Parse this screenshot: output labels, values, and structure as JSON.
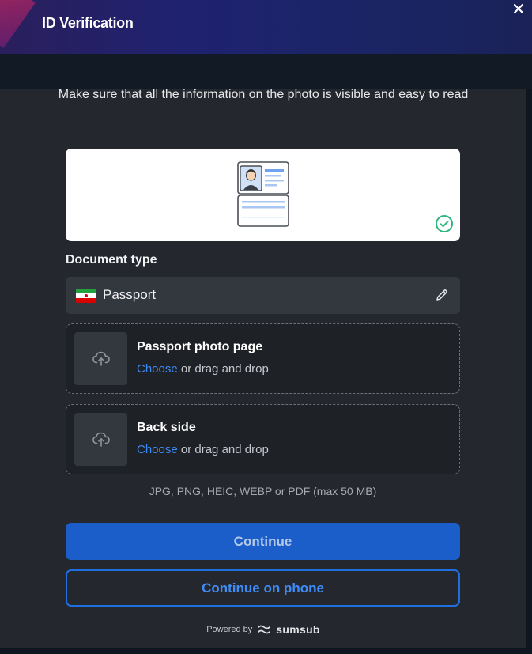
{
  "header": {
    "title": "ID Verification",
    "close_icon": "close-icon"
  },
  "main": {
    "instruction": "Make sure that all the information on the photo is visible and easy to read",
    "document_type_label": "Document type",
    "document_type_value": "Passport",
    "uploads": [
      {
        "title": "Passport photo page",
        "choose": "Choose",
        "hint": " or drag and drop"
      },
      {
        "title": "Back side",
        "choose": "Choose",
        "hint": " or drag and drop"
      }
    ],
    "formats": "JPG, PNG, HEIC, WEBP or PDF (max 50 MB)",
    "continue_label": "Continue",
    "continue_phone_label": "Continue on phone"
  },
  "footer": {
    "powered_by": "Powered by",
    "brand": "sumsub"
  },
  "colors": {
    "accent": "#1b5ec9",
    "link": "#3f8bf4",
    "success": "#2cb67d"
  }
}
